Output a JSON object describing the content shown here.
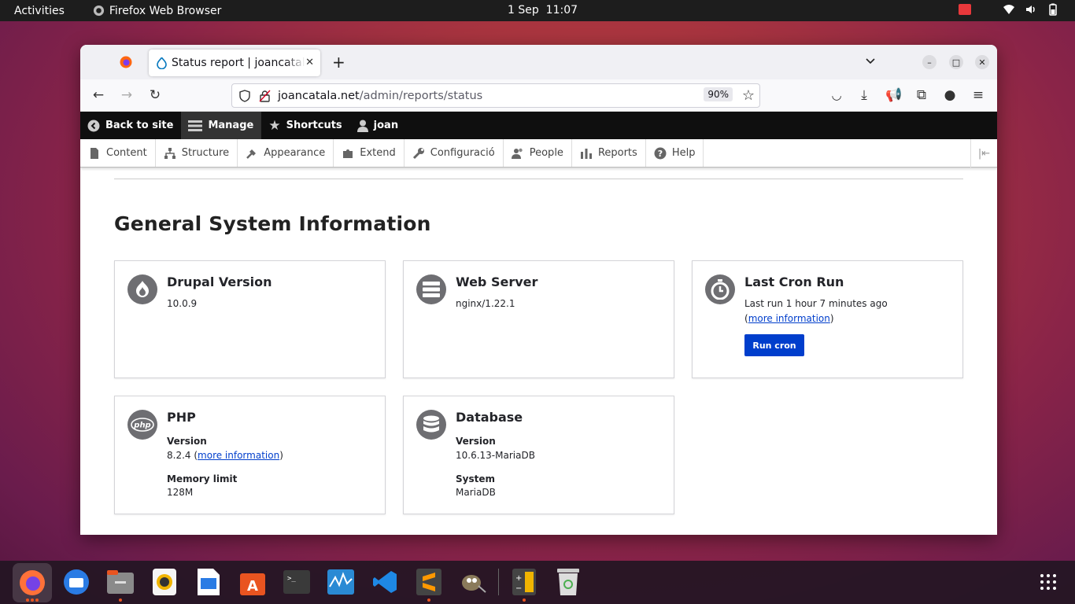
{
  "system": {
    "activities": "Activities",
    "app_name": "Firefox Web Browser",
    "date": "1 Sep",
    "time": "11:07"
  },
  "browser": {
    "tab_title": "Status report | joancatala.net",
    "new_tab": "+",
    "url_host": "joancatala.net",
    "url_path": "/admin/reports/status",
    "zoom": "90%"
  },
  "toolbar": {
    "back_to_site": "Back to site",
    "manage": "Manage",
    "shortcuts": "Shortcuts",
    "user": "joan"
  },
  "menu": {
    "items": [
      "Content",
      "Structure",
      "Appearance",
      "Extend",
      "Configuració",
      "People",
      "Reports",
      "Help"
    ]
  },
  "page": {
    "heading": "General System Information"
  },
  "cards": {
    "drupal": {
      "title": "Drupal Version",
      "value": "10.0.9"
    },
    "webserver": {
      "title": "Web Server",
      "value": "nginx/1.22.1"
    },
    "cron": {
      "title": "Last Cron Run",
      "value": "Last run 1 hour 7 minutes ago",
      "paren_open": "(",
      "link": "more information",
      "paren_close": ")",
      "button": "Run cron"
    },
    "php": {
      "title": "PHP",
      "version_label": "Version",
      "version": "8.2.4 (",
      "link": "more information",
      "paren_close": ")",
      "memory_label": "Memory limit",
      "memory": "128M"
    },
    "database": {
      "title": "Database",
      "version_label": "Version",
      "version": "10.6.13-MariaDB",
      "system_label": "System",
      "system": "MariaDB"
    }
  },
  "colors": {
    "accent": "#003ecc",
    "toolbar_bg": "#0f0f0f",
    "ubuntu_orange": "#e95420"
  },
  "icons": [
    "firefox-icon",
    "drupal-icon",
    "server-icon",
    "clock-icon",
    "php-icon",
    "database-icon"
  ]
}
